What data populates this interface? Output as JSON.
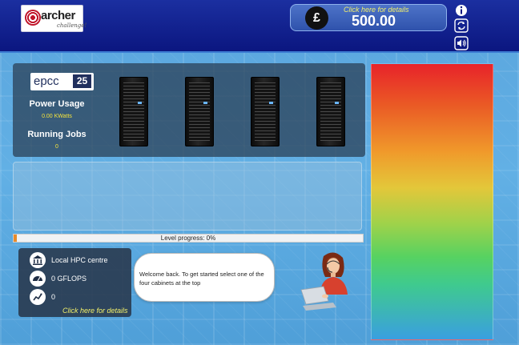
{
  "header": {
    "logo": {
      "word": "archer",
      "sub": "challenge!"
    },
    "money": {
      "symbol": "£",
      "details_label": "Click here for details",
      "amount": "500.00"
    },
    "icons": [
      "info-icon",
      "refresh-icon",
      "sound-icon"
    ]
  },
  "status_panel": {
    "logo": {
      "word": "epcc",
      "number": "25"
    },
    "power_label": "Power Usage",
    "power_value": "0.00 KWatts",
    "jobs_label": "Running Jobs",
    "jobs_value": "0",
    "cabinets": 4
  },
  "progress": {
    "label": "Level progress: 0%",
    "fraction": 0.0
  },
  "info_panel": {
    "location": "Local HPC centre",
    "gflops": "0 GFLOPS",
    "trend_value": "0",
    "details_label": "Click here for details",
    "icons": [
      "building-icon",
      "speedometer-icon",
      "trend-chart-icon"
    ]
  },
  "assistant": {
    "message": "Welcome back. To get started select one of the four cabinets at the top"
  },
  "gauge": {
    "level": 0.0
  },
  "colors": {
    "header": "#0b1680",
    "panel": "#283c50",
    "accent_yellow": "#f3f06a",
    "progress_fill": "#e88b2a"
  }
}
